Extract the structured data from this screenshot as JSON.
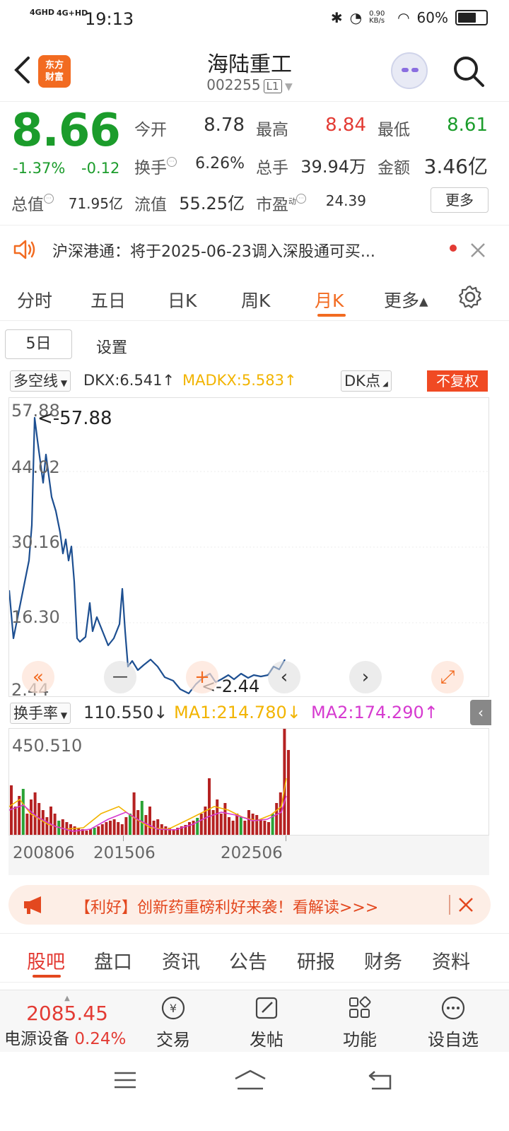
{
  "status_bar": {
    "network1": "4GHD",
    "network2": "4G+HD",
    "time": "19:13",
    "speed": "0.90 KB/s",
    "battery": "60%"
  },
  "header": {
    "logo_text_1": "东方",
    "logo_text_2": "财富",
    "stock_name": "海陆重工",
    "stock_code": "002255",
    "level_badge": "L1"
  },
  "quote": {
    "price": "8.66",
    "change_pct": "-1.37%",
    "change": "-0.12",
    "rows": [
      [
        {
          "label": "今开",
          "value": "8.78",
          "color": "#333333"
        },
        {
          "label": "最高",
          "value": "8.84",
          "color": "#e33b34"
        },
        {
          "label": "最低",
          "value": "8.61",
          "color": "#1b9c2b"
        }
      ],
      [
        {
          "label": "换手",
          "value": "6.26%"
        },
        {
          "label": "总手",
          "value": "39.94万"
        },
        {
          "label": "金额",
          "value": "3.46亿"
        }
      ],
      [
        {
          "label": "总值",
          "value": "71.95亿"
        },
        {
          "label": "流值",
          "value": "55.25亿"
        },
        {
          "label": "市盈",
          "label_sup": "动",
          "value": "24.39"
        }
      ]
    ],
    "more_label": "更多"
  },
  "notice": {
    "text": "沪深港通：将于2025-06-23调入深股通可买..."
  },
  "chart_tabs": [
    "分时",
    "五日",
    "日K",
    "周K",
    "月K",
    "更多▴"
  ],
  "active_tab_index": 4,
  "chart_options": {
    "period_button": "5日",
    "settings": "设置"
  },
  "indicator": {
    "selector": "多空线",
    "dkx": "DKX:6.541↑",
    "madkx": "MADKX:5.583↑",
    "dk_button": "DK点",
    "adjust_tag": "不复权"
  },
  "price_axis": [
    "57.88",
    "44.02",
    "30.16",
    "16.30",
    "2.44"
  ],
  "annotations": {
    "high": "<-57.88",
    "low": "<-2.44"
  },
  "volume_indicator": {
    "selector": "换手率",
    "value": "110.550↓",
    "ma1": "MA1:214.780↓",
    "ma2": "MA2:174.290↑",
    "max_label": "450.510"
  },
  "date_axis": [
    "200806",
    "201506",
    "202506"
  ],
  "chart_controls": {
    "left": "«",
    "minus": "—",
    "plus": "+",
    "prev": "‹",
    "next": "›",
    "expand": "⤢"
  },
  "ad": {
    "text": "【利好】创新药重磅利好来袭！看解读>>>"
  },
  "section_tabs": [
    "股吧",
    "盘口",
    "资讯",
    "公告",
    "研报",
    "财务",
    "资料"
  ],
  "active_section_index": 0,
  "bottom_bar": {
    "index_value": "2085.45",
    "index_name": "电源设备",
    "index_change": "0.24%",
    "items": [
      "交易",
      "发帖",
      "功能",
      "设自选"
    ]
  },
  "colors": {
    "accent": "#f26b21",
    "up": "#e33b34",
    "down": "#1b9c2b",
    "line": "#1d4f91",
    "ma1": "#f2b400",
    "ma2": "#d63ad0"
  },
  "icons": [
    "back-arrow-icon",
    "robot-avatar-icon",
    "search-icon",
    "speaker-icon",
    "close-icon",
    "gear-icon",
    "megaphone-icon",
    "trade-icon",
    "edit-icon",
    "grid-icon",
    "chat-icon",
    "menu-icon",
    "home-icon",
    "return-icon"
  ]
}
